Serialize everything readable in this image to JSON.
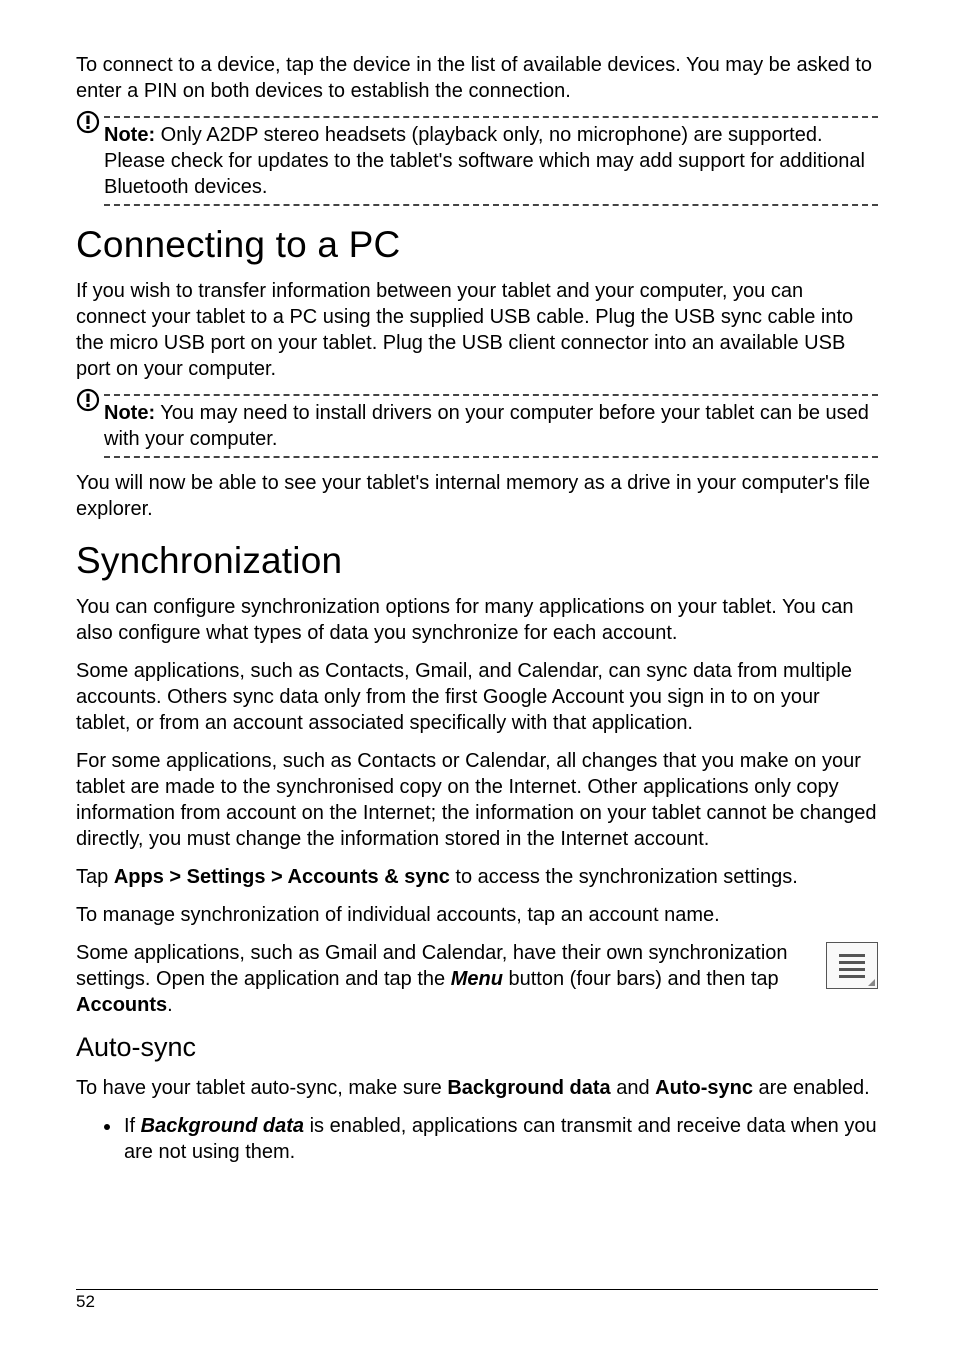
{
  "intro": "To connect to a device, tap the device in the list of available devices. You may be asked to enter a PIN on both devices to establish the connection.",
  "note1_label": "Note:",
  "note1_text": " Only A2DP stereo headsets (playback only, no microphone) are supported. Please check for updates to the tablet's software which may add support for additional Bluetooth devices.",
  "h1_connecting": "Connecting to a PC",
  "connecting_p1": "If you wish to transfer information between your tablet and your computer, you can connect your tablet to a PC using the supplied USB cable. Plug the USB sync cable into the micro USB port on your tablet. Plug the USB client connector into an available USB port on your computer.",
  "note2_label": "Note:",
  "note2_text": " You may need to install drivers on your computer before your tablet can be used with your computer.",
  "connecting_p2": "You will now be able to see your tablet's internal memory as a drive in your computer's file explorer.",
  "h1_sync": "Synchronization",
  "sync_p1": "You can configure synchronization options for many applications on your tablet. You can also configure what types of data you synchronize for each account.",
  "sync_p2": "Some applications, such as Contacts, Gmail, and Calendar, can sync data from multiple accounts. Others sync data only from the first Google Account you sign in to on your tablet, or from an account associated specifically with that application.",
  "sync_p3": "For some applications, such as Contacts or Calendar, all changes that you make on your tablet are made to the synchronised copy on the Internet. Other applications only copy information from account on the Internet; the information on your tablet cannot be changed directly, you must change the information stored in the Internet account.",
  "sync_tap_pre": "Tap ",
  "sync_tap_bold": "Apps > Settings > Accounts & sync",
  "sync_tap_post": " to access the synchronization settings.",
  "sync_p5": "To manage synchronization of individual accounts, tap an account name.",
  "sync_p6_pre": "Some applications, such as Gmail and Calendar, have their own synchronization settings. Open the application and tap the ",
  "sync_p6_menu": "Menu",
  "sync_p6_mid": " button (four bars) and then tap ",
  "sync_p6_accounts": "Accounts",
  "sync_p6_end": ".",
  "h2_autosync": "Auto-sync",
  "autosync_p1_pre": "To have your tablet auto-sync, make sure ",
  "autosync_bgdata": "Background data",
  "autosync_and": " and ",
  "autosync_as": "Auto-sync",
  "autosync_p1_post": " are enabled.",
  "bullet_pre": "If ",
  "bullet_bi": "Background data",
  "bullet_post": " is enabled, applications can transmit and receive data when you are not using them.",
  "page_number": "52"
}
